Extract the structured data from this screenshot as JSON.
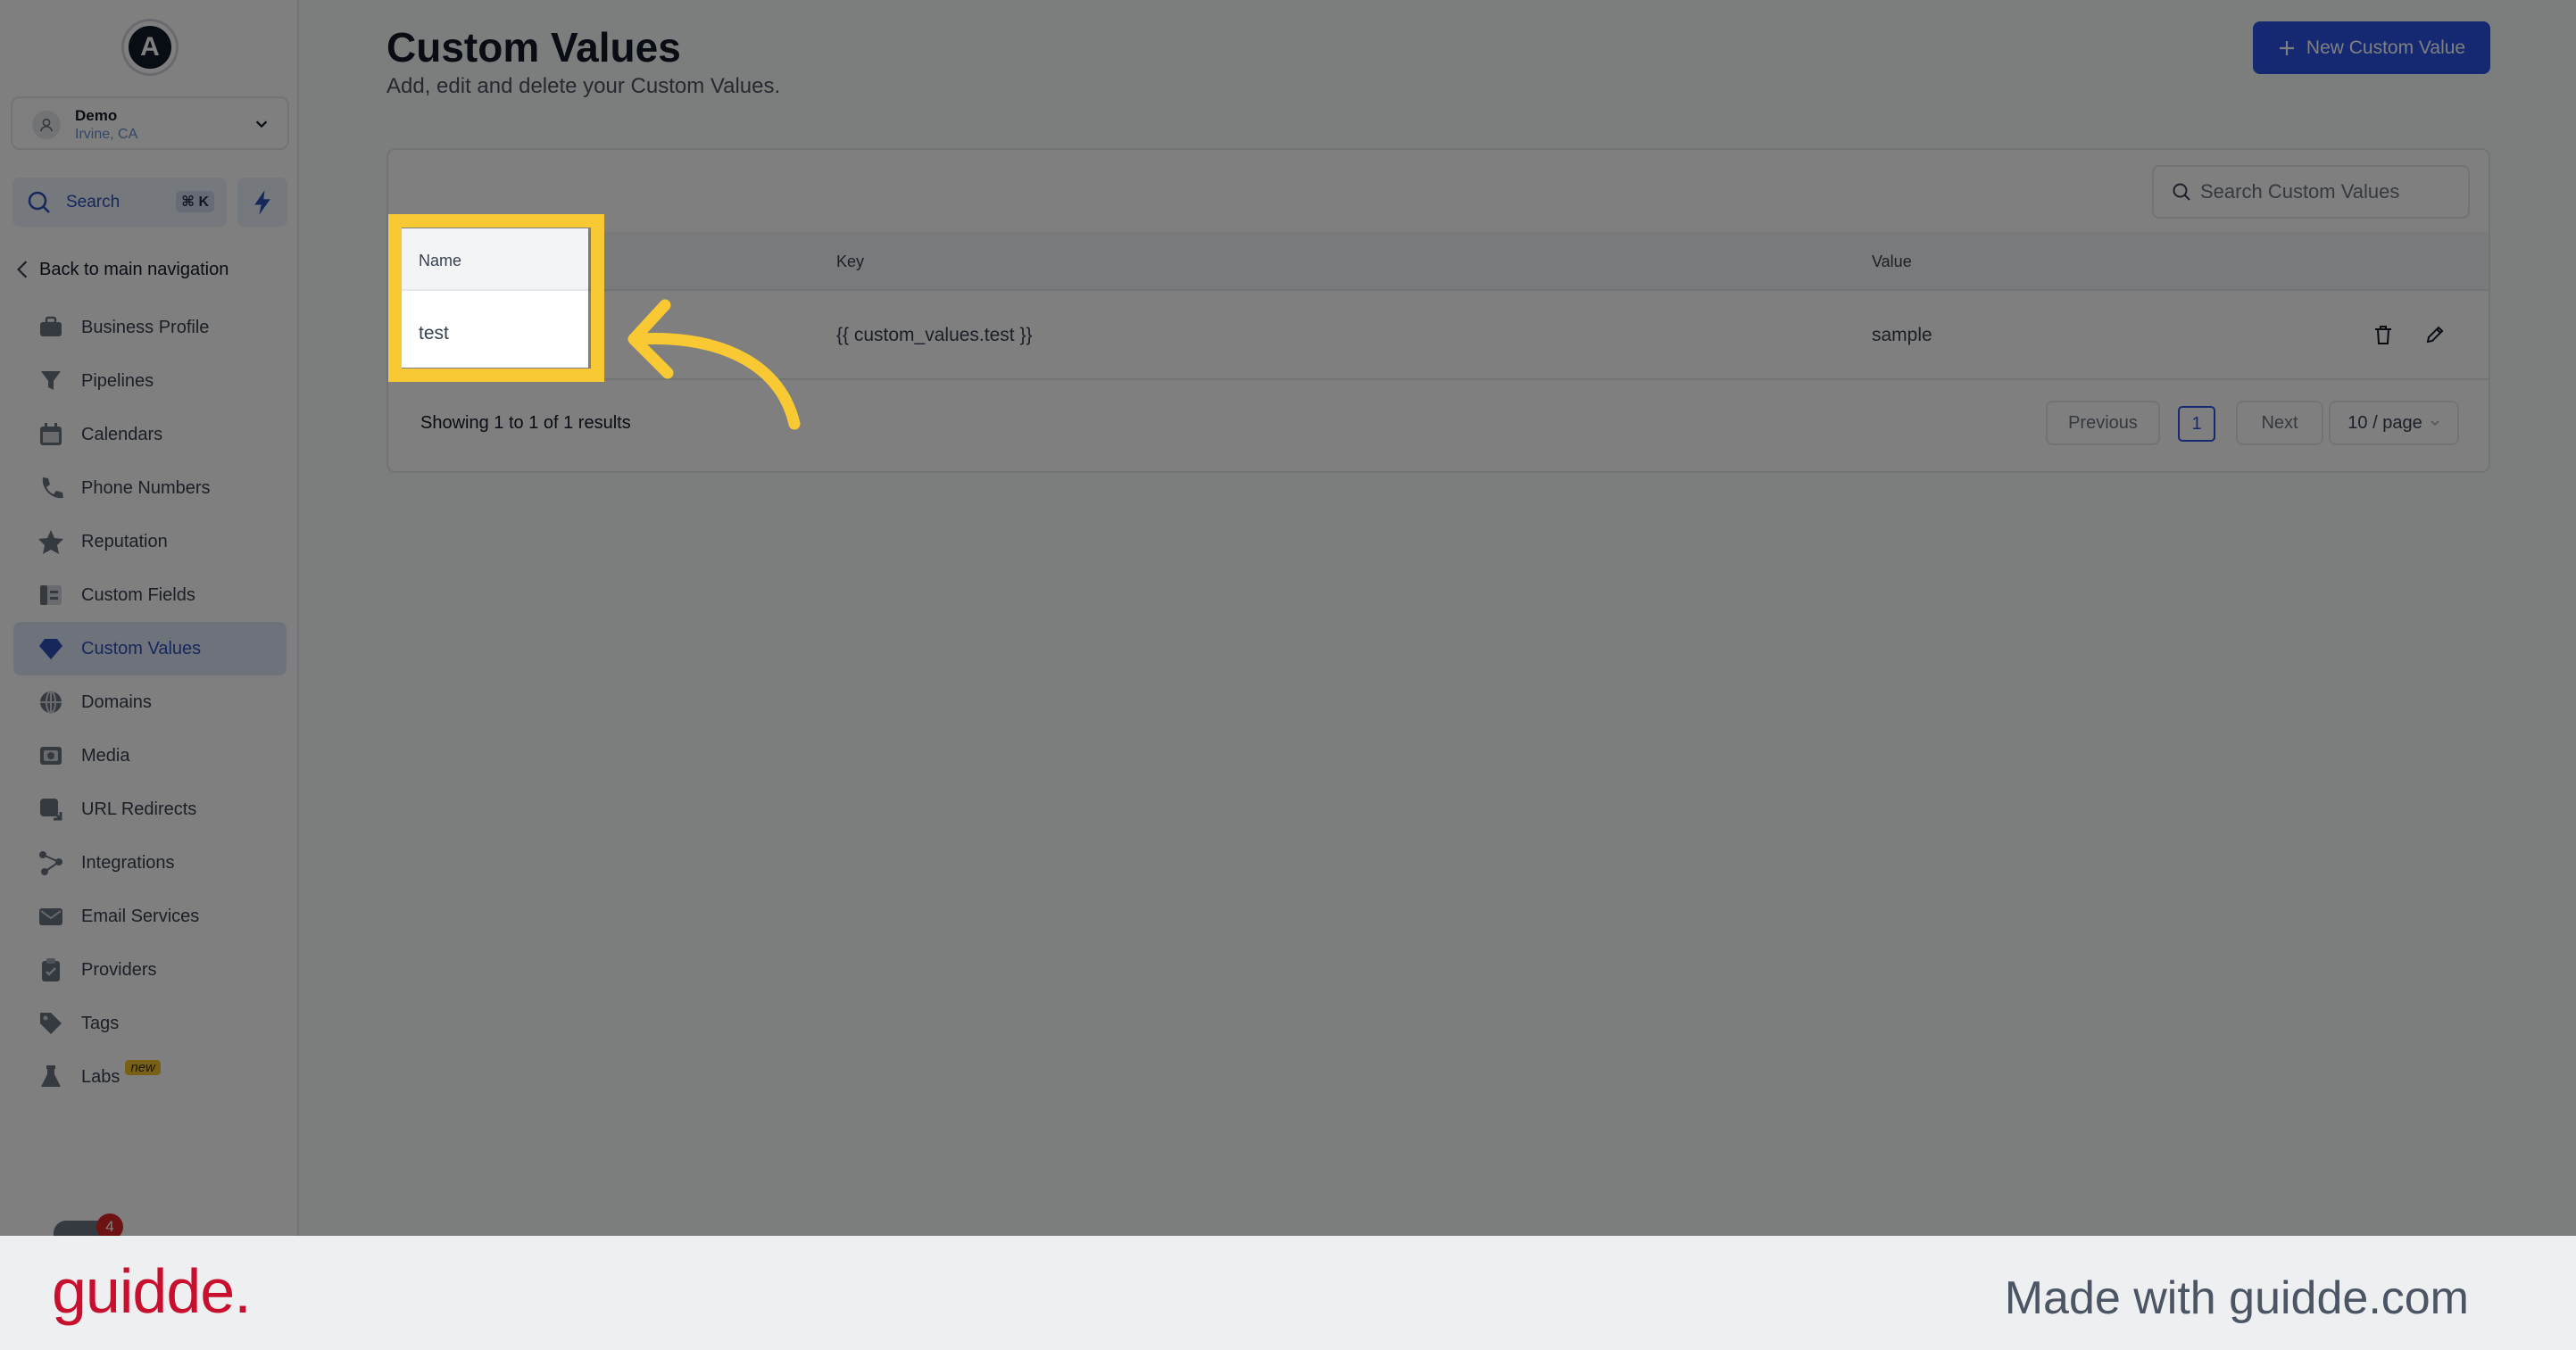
{
  "sidebar": {
    "logo_letter": "A",
    "account": {
      "name": "Demo",
      "location": "Irvine, CA"
    },
    "search": {
      "label": "Search",
      "shortcut": "⌘ K"
    },
    "back_label": "Back to main navigation",
    "items": [
      {
        "label": "Business Profile",
        "icon": "briefcase-icon"
      },
      {
        "label": "Pipelines",
        "icon": "filter-icon"
      },
      {
        "label": "Calendars",
        "icon": "calendar-icon"
      },
      {
        "label": "Phone Numbers",
        "icon": "phone-icon"
      },
      {
        "label": "Reputation",
        "icon": "star-icon"
      },
      {
        "label": "Custom Fields",
        "icon": "fields-icon"
      },
      {
        "label": "Custom Values",
        "icon": "gem-icon",
        "active": true
      },
      {
        "label": "Domains",
        "icon": "globe-icon"
      },
      {
        "label": "Media",
        "icon": "media-icon"
      },
      {
        "label": "URL Redirects",
        "icon": "redirect-icon"
      },
      {
        "label": "Integrations",
        "icon": "integrations-icon"
      },
      {
        "label": "Email Services",
        "icon": "email-icon"
      },
      {
        "label": "Providers",
        "icon": "clipboard-icon"
      },
      {
        "label": "Tags",
        "icon": "tag-icon"
      },
      {
        "label": "Labs",
        "icon": "flask-icon",
        "badge": "new"
      }
    ],
    "notification_count": "4"
  },
  "header": {
    "title": "Custom Values",
    "subtitle": "Add, edit and delete your Custom Values.",
    "new_button_label": "New Custom Value"
  },
  "table": {
    "search_placeholder": "Search Custom Values",
    "columns": [
      "Name",
      "Key",
      "Value"
    ],
    "rows": [
      {
        "name": "test",
        "key": "{{ custom_values.test }}",
        "value": "sample"
      }
    ]
  },
  "pagination": {
    "summary": "Showing 1 to 1 of 1 results",
    "previous_label": "Previous",
    "current_page": "1",
    "next_label": "Next",
    "page_size": "10 / page"
  },
  "footer": {
    "brand": "guidde.",
    "made_with": "Made with guidde.com"
  },
  "colors": {
    "primary": "#2952e3",
    "highlight": "#f9c933",
    "brand_red": "#c8102e"
  }
}
